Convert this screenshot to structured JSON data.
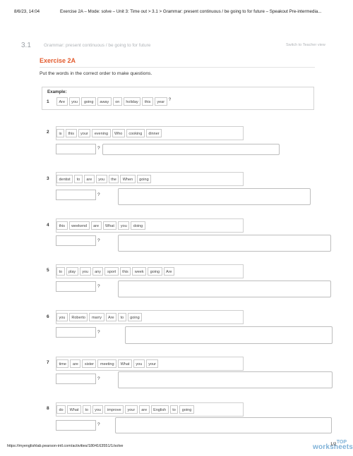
{
  "header": {
    "datetime": "8/6/23, 14:04",
    "title": "Exercise 2A – Mode: solve – Unit 3: Time out > 3.1 > Grammar: present continuous / be going to for future – Speakout Pre-intermedia..."
  },
  "section": {
    "number": "3.1",
    "title": "Grammar: present continuous / be going to for future",
    "teacher_link": "Switch to Teacher view"
  },
  "exercise": {
    "title": "Exercise 2A",
    "instruction": "Put the words in the correct order to make questions."
  },
  "example": {
    "label": "Example:",
    "number": "1",
    "words": [
      "Are",
      "you",
      "going",
      "away",
      "on",
      "holiday",
      "this",
      "year"
    ],
    "qmark": "?"
  },
  "questions": [
    {
      "number": "2",
      "words": [
        "is",
        "this",
        "your",
        "evening",
        "Who",
        "cooking",
        "dinner"
      ],
      "qmark": "?"
    },
    {
      "number": "3",
      "words": [
        "dentist",
        "to",
        "are",
        "you",
        "the",
        "When",
        "going"
      ],
      "qmark": "?"
    },
    {
      "number": "4",
      "words": [
        "this",
        "weekend",
        "are",
        "What",
        "you",
        "doing"
      ],
      "qmark": "?"
    },
    {
      "number": "5",
      "words": [
        "to",
        "play",
        "you",
        "any",
        "sport",
        "this",
        "week",
        "going",
        "Are"
      ],
      "qmark": "?"
    },
    {
      "number": "6",
      "words": [
        "you",
        "Roberto",
        "marry",
        "Are",
        "to",
        "going"
      ],
      "qmark": "?"
    },
    {
      "number": "7",
      "words": [
        "time",
        "are",
        "sister",
        "meeting",
        "What",
        "you",
        "your"
      ],
      "qmark": "?"
    },
    {
      "number": "8",
      "words": [
        "do",
        "What",
        "to",
        "you",
        "improve",
        "your",
        "are",
        "English",
        "to",
        "going"
      ],
      "qmark": "?"
    }
  ],
  "footer": {
    "url": "https://myenglishlab.pearson-intl.com/activities/1804163551/1/solve",
    "page": "1/2"
  },
  "watermark": {
    "line1": "TOP",
    "line2": "worksheets"
  }
}
